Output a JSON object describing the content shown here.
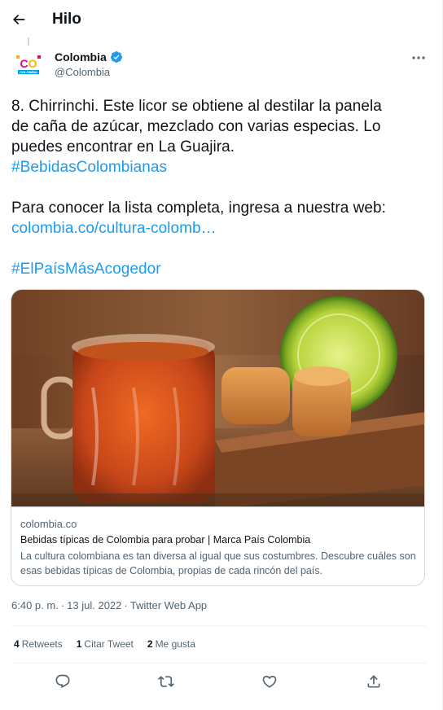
{
  "header": {
    "title": "Hilo",
    "back_icon": "arrow-left-icon"
  },
  "tweet": {
    "author": {
      "name": "Colombia",
      "handle": "@Colombia",
      "avatar_text": "CO",
      "avatar_subtext": "COLOMBIA",
      "verified_color": "#1d9bf0"
    },
    "text_lines": [
      "8. Chirrinchi. Este licor se obtiene al destilar la panela",
      "de caña de azúcar, mezclado con varias especias. Lo",
      "puedes encontrar en La Guajira."
    ],
    "hashtag_1": "#BebidasColombianas",
    "text_line_4": "Para conocer la lista completa, ingresa a nuestra web:",
    "link": "colombia.co/cultura-colomb…",
    "hashtag_2": "#ElPaísMásAcogedor",
    "card": {
      "domain": "colombia.co",
      "title": "Bebidas típicas de Colombia para probar | Marca País Colombia",
      "description": "La cultura colombiana es tan diversa al igual que sus costumbres. Descubre cuáles son esas bebidas típicas de Colombia, propias de cada rincón del país."
    },
    "time": "6:40 p. m.",
    "date": "13 jul. 2022",
    "app": "Twitter Web App",
    "separator": "·",
    "stats": {
      "retweets_count": "4",
      "retweets_label": "Retweets",
      "quotes_count": "1",
      "quotes_label": "Citar Tweet",
      "likes_count": "2",
      "likes_label": "Me gusta"
    }
  },
  "colors": {
    "link": "#1d9bf0",
    "secondary": "#536471",
    "text": "#0f1419",
    "border": "#cfd9de"
  }
}
